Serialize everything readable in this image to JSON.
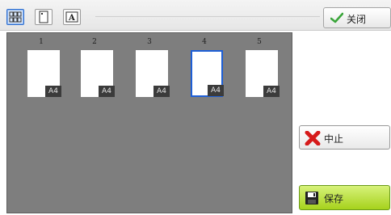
{
  "toolbar": {
    "view_buttons": [
      {
        "icon": "thumbnail-grid-icon",
        "active": true
      },
      {
        "icon": "single-page-icon",
        "active": false
      },
      {
        "icon": "text-page-icon",
        "active": false
      }
    ],
    "close_label": "关闭"
  },
  "pages": [
    {
      "number": "1",
      "size": "A4",
      "selected": false
    },
    {
      "number": "2",
      "size": "A4",
      "selected": false
    },
    {
      "number": "3",
      "size": "A4",
      "selected": false
    },
    {
      "number": "4",
      "size": "A4",
      "selected": true
    },
    {
      "number": "5",
      "size": "A4",
      "selected": false
    }
  ],
  "actions": {
    "stop_label": "中止",
    "save_label": "保存"
  },
  "colors": {
    "panel_bg": "#7e7e7e",
    "selection": "#1e5fd6",
    "save_green": "#a6d21c",
    "stop_red": "#d61a1a"
  }
}
